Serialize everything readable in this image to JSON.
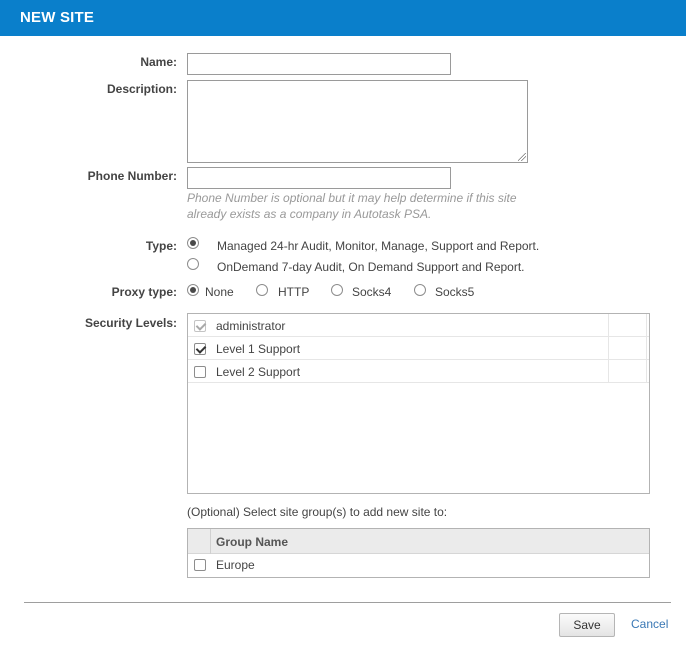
{
  "header": {
    "title": "NEW SITE",
    "color": "#0a7fcb"
  },
  "form": {
    "name_label": "Name:",
    "name_value": "",
    "description_label": "Description:",
    "description_value": "",
    "phone_label": "Phone Number:",
    "phone_value": "",
    "phone_hint": "Phone Number is optional but it may help determine if this site already exists as a company in Autotask PSA.",
    "type_label": "Type:",
    "type_options": [
      {
        "label": "Managed 24-hr Audit, Monitor, Manage, Support and Report.",
        "selected": true
      },
      {
        "label": "OnDemand 7-day Audit, On Demand Support and Report.",
        "selected": false
      }
    ],
    "proxy_label": "Proxy type:",
    "proxy_options": [
      {
        "label": "None",
        "selected": true
      },
      {
        "label": "HTTP",
        "selected": false
      },
      {
        "label": "Socks4",
        "selected": false
      },
      {
        "label": "Socks5",
        "selected": false
      }
    ],
    "security_label": "Security Levels:",
    "security_levels": [
      {
        "label": "administrator",
        "checked": true,
        "disabled": true
      },
      {
        "label": "Level 1 Support",
        "checked": true,
        "disabled": false
      },
      {
        "label": "Level 2 Support",
        "checked": false,
        "disabled": false
      }
    ],
    "site_group_prompt": "(Optional) Select site group(s) to add new site to:",
    "site_group_header": "Group Name",
    "site_groups": [
      {
        "label": "Europe",
        "checked": false
      }
    ]
  },
  "footer": {
    "save_label": "Save",
    "cancel_label": "Cancel",
    "link_color": "#3a78b5"
  }
}
